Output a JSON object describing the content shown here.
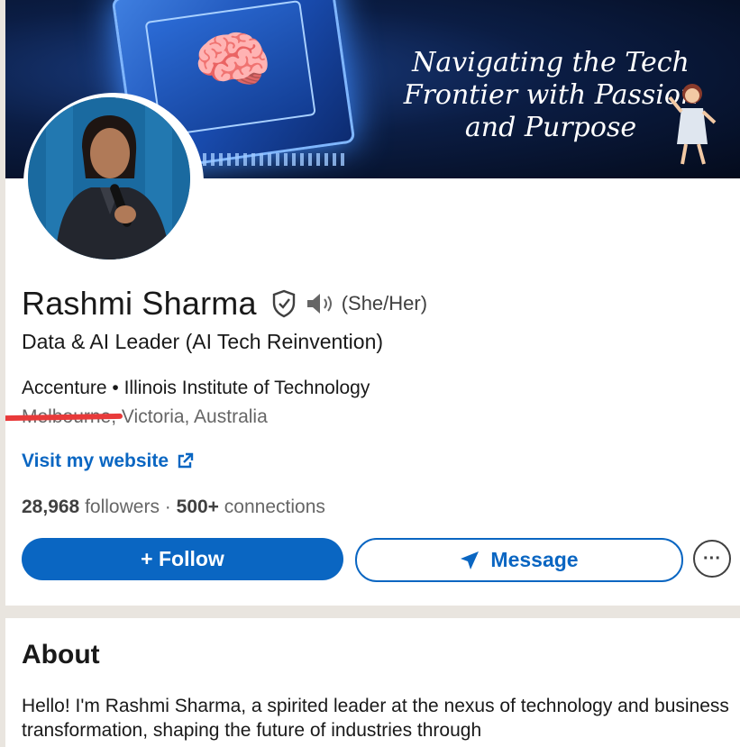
{
  "banner": {
    "tagline": "Navigating the Tech Frontier with Passion and Purpose"
  },
  "profile": {
    "name": "Rashmi Sharma",
    "pronouns": "(She/Her)",
    "headline": "Data & AI Leader (AI Tech Reinvention)",
    "orgs": "Accenture • Illinois Institute of Technology",
    "location": "Melbourne, Victoria, Australia",
    "website_label": "Visit my website",
    "followers_count": "28,968",
    "followers_label": "followers",
    "stats_separator": "·",
    "connections_count": "500+",
    "connections_label": "connections"
  },
  "actions": {
    "follow_label": "+ Follow",
    "message_label": "Message",
    "more_label": "···"
  },
  "about": {
    "title": "About",
    "text": "Hello! I'm Rashmi Sharma, a spirited leader at the nexus of technology and business transformation, shaping the future of industries through"
  },
  "colors": {
    "brand_blue": "#0a66c2",
    "redaction_red": "#e83a3a"
  },
  "icons": [
    "verified-shield-icon",
    "speaker-icon",
    "external-link-icon",
    "send-icon",
    "more-icon"
  ]
}
